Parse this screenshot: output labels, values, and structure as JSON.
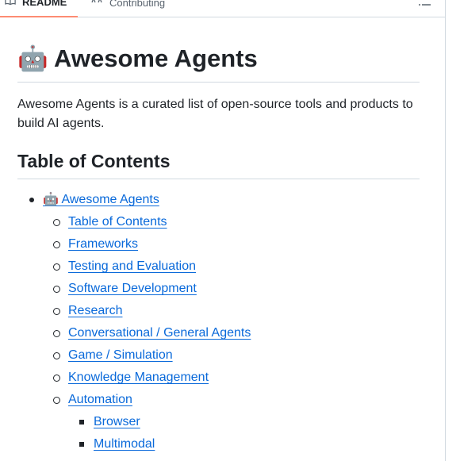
{
  "tabs": {
    "readme_label": "README",
    "contributing_label": "Contributing"
  },
  "readme": {
    "title": "🤖 Awesome Agents",
    "description": "Awesome Agents is a curated list of open-source tools and products to build AI agents.",
    "toc_heading": "Table of Contents",
    "toc": {
      "root": "🤖 Awesome Agents",
      "items": [
        "Table of Contents",
        "Frameworks",
        "Testing and Evaluation",
        "Software Development",
        "Research",
        "Conversational / General Agents",
        "Game / Simulation",
        "Knowledge Management",
        "Automation"
      ],
      "automation_subitems": [
        "Browser",
        "Multimodal"
      ]
    }
  },
  "colors": {
    "link": "#0969da",
    "active_tab_underline": "#fd8c73",
    "border": "#d1d9e0",
    "text": "#1f2328"
  }
}
